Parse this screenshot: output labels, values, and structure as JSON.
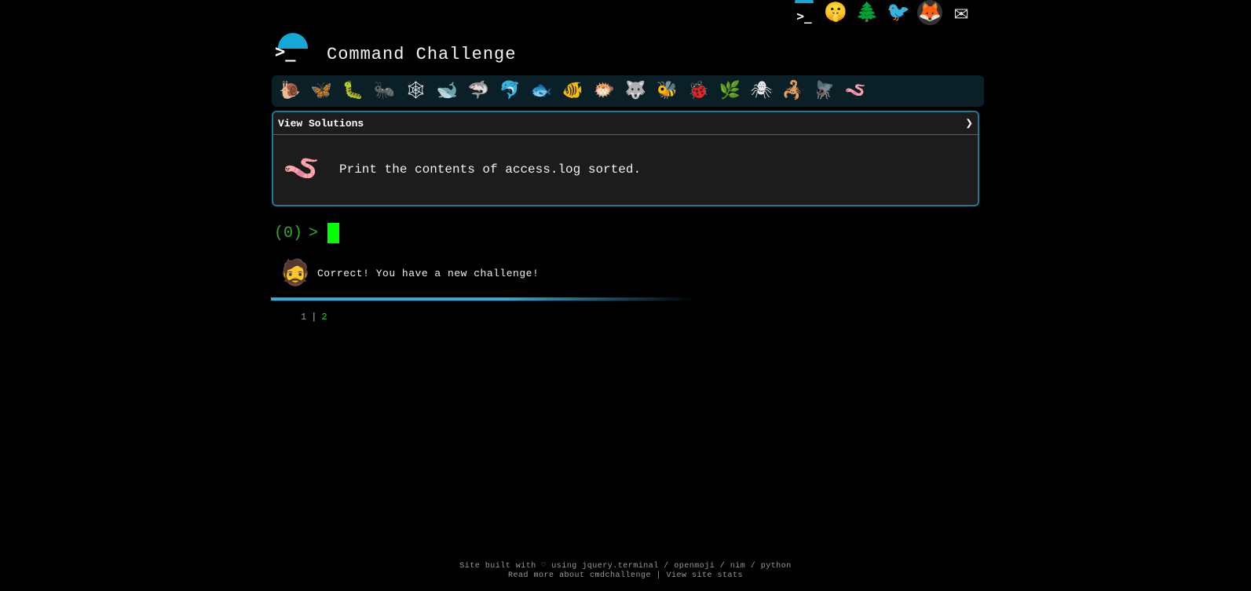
{
  "top_icons": [
    {
      "name": "cmdchallenge-icon",
      "glyph": ">_"
    },
    {
      "name": "shushing-face-icon",
      "glyph": "🤫"
    },
    {
      "name": "tree-icon",
      "glyph": "🌲"
    },
    {
      "name": "twitter-icon",
      "glyph": "🐦"
    },
    {
      "name": "gitlab-icon",
      "glyph": "🦊"
    },
    {
      "name": "mail-icon",
      "glyph": "✉"
    }
  ],
  "header": {
    "logo_glyph": ">_",
    "title": "Command Challenge"
  },
  "challenges": [
    {
      "name": "snail-icon",
      "glyph": "🐌"
    },
    {
      "name": "butterfly-icon",
      "glyph": "🦋"
    },
    {
      "name": "caterpillar-icon",
      "glyph": "🐛"
    },
    {
      "name": "ant-icon",
      "glyph": "🐜"
    },
    {
      "name": "web-icon",
      "glyph": "🕸"
    },
    {
      "name": "whale-icon",
      "glyph": "🐋"
    },
    {
      "name": "shark-icon",
      "glyph": "🦈"
    },
    {
      "name": "dolphin-icon",
      "glyph": "🐬"
    },
    {
      "name": "fish-icon",
      "glyph": "🐟"
    },
    {
      "name": "tropical-fish-icon",
      "glyph": "🐠"
    },
    {
      "name": "blowfish-icon",
      "glyph": "🐡"
    },
    {
      "name": "wolf-icon",
      "glyph": "🐺"
    },
    {
      "name": "bee-icon",
      "glyph": "🐝"
    },
    {
      "name": "ladybug-icon",
      "glyph": "🐞"
    },
    {
      "name": "leaf-bug-icon",
      "glyph": "🌿"
    },
    {
      "name": "spider-icon",
      "glyph": "🕷"
    },
    {
      "name": "scorpion-icon",
      "glyph": "🦂"
    },
    {
      "name": "fly-icon",
      "glyph": "🪰"
    },
    {
      "name": "worm-icon",
      "glyph": "🪱"
    }
  ],
  "panel": {
    "view_solutions": "View Solutions",
    "chevron": "❯",
    "worm_glyph": "🪱",
    "task": "Print the contents of access.log sorted."
  },
  "prompt": {
    "open": "(",
    "count": "0",
    "close": ")",
    "gt": ">"
  },
  "feedback": {
    "avatar_glyph": "🧔",
    "message": "Correct! You have a new challenge!"
  },
  "output": {
    "line_number": "1",
    "separator": "|",
    "value": "2"
  },
  "footer": {
    "line1": "Site built with ♡ using jquery.terminal / openmoji / nim / python",
    "read_more": "Read more about cmdchallenge",
    "sep": " | ",
    "stats": "View site stats"
  }
}
